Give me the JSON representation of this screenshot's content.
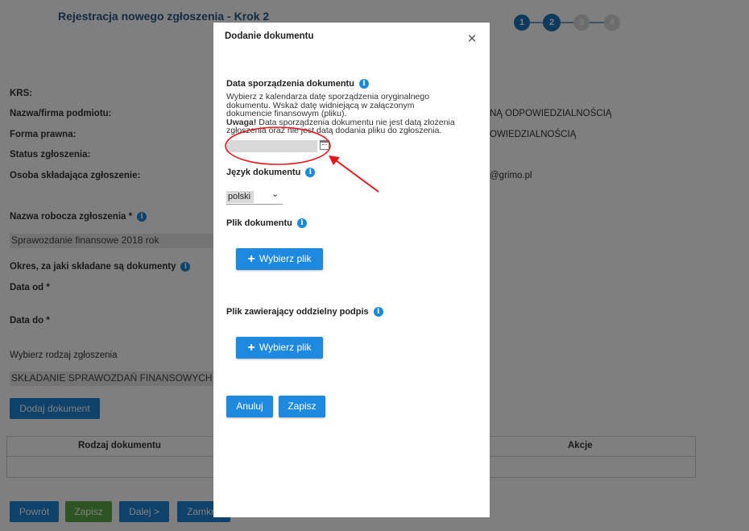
{
  "background": {
    "title": "Rejestracja nowego zgłoszenia - Krok 2",
    "steps": [
      "1",
      "2",
      "3",
      "4"
    ],
    "fields": {
      "krs_label": "KRS:",
      "name_label": "Nazwa/firma podmiotu:",
      "name_value_fragment": "NĄ ODPOWIEDZIALNOŚCIĄ",
      "legal_form_label": "Forma prawna:",
      "legal_form_value_fragment": "OWIEDZIALNOŚCIĄ",
      "status_label": "Status zgłoszenia:",
      "person_label": "Osoba składająca zgłoszenie:",
      "person_value_fragment": "@grimo.pl",
      "working_name_label": "Nazwa robocza zgłoszenia *",
      "working_name_value": "Sprawozdanie finansowe 2018 rok",
      "period_label": "Okres, za jaki składane są dokumenty",
      "date_from_label": "Data od *",
      "date_to_label": "Data do *",
      "type_label": "Wybierz rodzaj zgłoszenia",
      "type_value": "SKŁADANIE SPRAWOZDAŃ FINANSOWYCH"
    },
    "add_document_button": "Dodaj dokument",
    "table": {
      "col_doc_type": "Rodzaj dokumentu",
      "col_actions": "Akcje"
    },
    "footer_buttons": {
      "back": "Powrót",
      "save": "Zapisz",
      "next": "Dalej >",
      "close": "Zamknij"
    }
  },
  "modal": {
    "title": "Dodanie dokumentu",
    "close_icon": "×",
    "date_section": {
      "label": "Data sporządzenia dokumentu",
      "help_line1": "Wybierz z kalendarza datę sporządzenia oryginalnego",
      "help_line2": "dokumentu. Wskaż datę widniejącą w załączonym",
      "help_line3": "dokumencie finansowym (pliku).",
      "warning_bold": "Uwaga!",
      "warning_text1": " Data sporządzenia dokumentu nie jest datą złożenia",
      "warning_text2": "zgłoszenia oraz nie jest datą dodania pliku do zgłoszenia.",
      "value": ""
    },
    "language_section": {
      "label": "Język dokumentu",
      "value": "polski"
    },
    "file_section": {
      "label": "Plik dokumentu",
      "button": "Wybierz plik"
    },
    "signature_section": {
      "label": "Plik zawierający oddzielny podpis",
      "button": "Wybierz plik"
    },
    "cancel_button": "Anuluj",
    "save_button": "Zapisz",
    "info_icon": "i"
  },
  "colors": {
    "accent": "#1d8ae0",
    "annotation": "#e8141c",
    "step_active": "#1c74b8"
  }
}
